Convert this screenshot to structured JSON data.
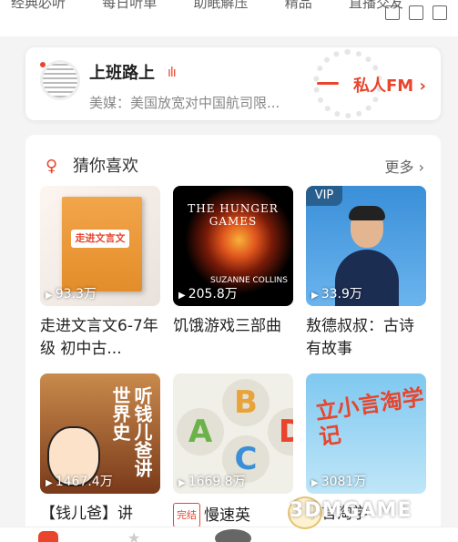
{
  "top_nav": {
    "items": [
      "经典必听",
      "每日听单",
      "助眠解压",
      "精品",
      "直播交友"
    ]
  },
  "window_icons": [
    "external-link-icon",
    "minimize-icon",
    "fullscreen-icon"
  ],
  "fm": {
    "title": "上班路上",
    "bars": "ılı",
    "subtitle": "美媒：美国放宽对中国航司限...",
    "link_label": "私人FM ›"
  },
  "guess": {
    "title": "猜你喜欢",
    "more_label": "更多 ›",
    "cards": [
      {
        "title": "走进文言文6-7年级 初中古...",
        "play_count": "93.3万",
        "cover_text": "走进文言文",
        "vip": ""
      },
      {
        "title": "饥饿游戏三部曲",
        "play_count": "205.8万",
        "cover_text": "THE HUNGER GAMES",
        "cover_author": "SUZANNE COLLINS",
        "vip": ""
      },
      {
        "title": "敖德叔叔：古诗有故事",
        "play_count": "33.9万",
        "vip": "VIP"
      },
      {
        "title": "【钱儿爸】讲",
        "play_count": "1467.4万",
        "cover_text": "听钱儿爸讲世界史",
        "vip": ""
      },
      {
        "title": "慢速英",
        "badge": "完结",
        "play_count": "1669.8万",
        "vip": ""
      },
      {
        "title": "小言淘学",
        "play_count": "3081万",
        "cover_text": "立小言淘学记",
        "vip": ""
      }
    ]
  },
  "watermark": "3DMGAME",
  "colors": {
    "accent": "#e8452c",
    "background": "#f4f4f4",
    "card": "#ffffff"
  }
}
